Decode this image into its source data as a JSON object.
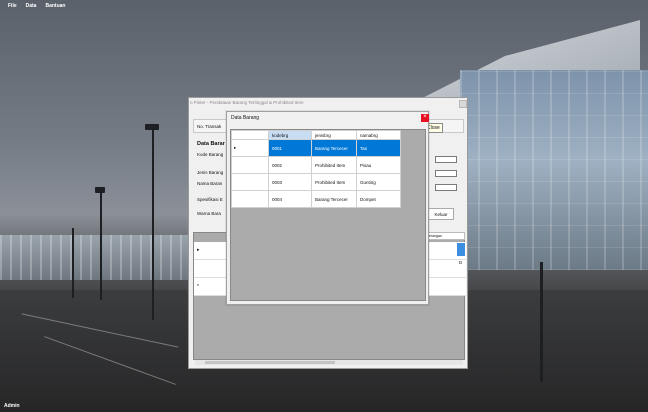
{
  "menu": {
    "items": [
      "File",
      "Data",
      "Bantuan"
    ]
  },
  "status": {
    "user": "Admin"
  },
  "main_form": {
    "title": "n Pinter - Pendataan Barang Tertinggal & Prohibited Item",
    "no_transaksi_label": "No. Transak",
    "section_heading": "Data Barar",
    "kode_barang_label": "Kode Barang",
    "jenis_barang_label": "Jenis Barang",
    "nama_barang_label": "Nama Baran",
    "spesifikasi_label": "Spesifikasi E",
    "warna_barang_label": "Warna Bara",
    "keluar_label": "Keluar",
    "grid_header_right": "terangan",
    "grid_new_row_marker": "*",
    "grid_current_marker": "▸",
    "grid_cell_d": "D"
  },
  "tooltip": {
    "close": "Close"
  },
  "dialog": {
    "title": "Data Barang",
    "close_glyph": "×",
    "columns": [
      "kodebrg",
      "jenisbrg",
      "namabrg"
    ],
    "current_row_marker": "▸",
    "rows": [
      {
        "kodebrg": "0001",
        "jenisbrg": "Barang Tercecer",
        "namabrg": "Tas",
        "selected": true
      },
      {
        "kodebrg": "0002",
        "jenisbrg": "Prohibited Item",
        "namabrg": "Pisau",
        "selected": false
      },
      {
        "kodebrg": "0003",
        "jenisbrg": "Prohibited Item",
        "namabrg": "Gunting",
        "selected": false
      },
      {
        "kodebrg": "0004",
        "jenisbrg": "Barang Tercecer",
        "namabrg": "Dompet",
        "selected": false
      }
    ],
    "colors": {
      "selection": "#0078d7",
      "close": "#e81123"
    }
  }
}
